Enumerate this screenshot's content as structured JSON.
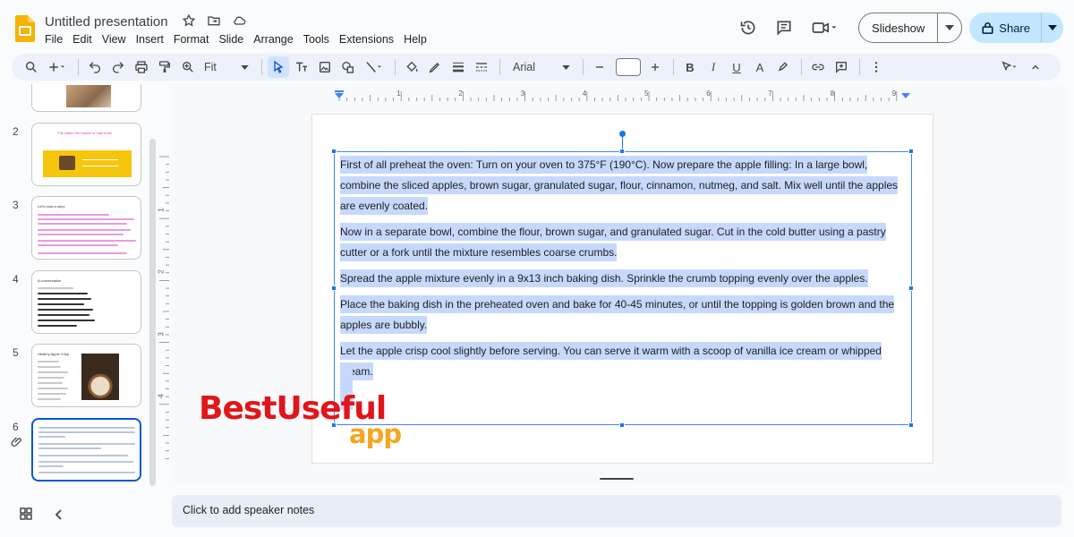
{
  "app": {
    "doc_title": "Untitled presentation",
    "menus": [
      "File",
      "Edit",
      "View",
      "Insert",
      "Format",
      "Slide",
      "Arrange",
      "Tools",
      "Extensions",
      "Help"
    ],
    "slideshow_label": "Slideshow",
    "share_label": "Share"
  },
  "toolbar": {
    "zoom": "Fit",
    "font": "Arial",
    "font_size": ""
  },
  "filmstrip": {
    "slides": [
      {
        "num": "2",
        "title": "The watch the makes of mail ends"
      },
      {
        "num": "3",
        "title": "Let's read a story"
      },
      {
        "num": "4",
        "title": "A conversation"
      },
      {
        "num": "5",
        "title": "Healthy Apple Crisp"
      },
      {
        "num": "6",
        "title": ""
      }
    ]
  },
  "slide": {
    "paragraphs": [
      "First of all preheat the oven: Turn on your oven to 375°F (190°C). Now prepare the apple filling: In a large bowl, combine the sliced apples, brown sugar, granulated sugar, flour, cinnamon, nutmeg, and salt. Mix well until the apples are evenly coated.",
      "Now in a separate bowl, combine the flour, brown sugar, and granulated sugar. Cut in the cold butter using a pastry cutter or a fork until the mixture resembles coarse crumbs.",
      "Spread the apple mixture evenly in a 9x13 inch baking dish. Sprinkle the crumb topping evenly over the apples.",
      "Place the baking dish in the preheated oven and bake for 40-45 minutes, or until the topping is golden brown and the apples are bubbly.",
      "Let the apple crisp cool slightly before serving. You can serve it warm with a scoop of vanilla ice cream or whipped cream."
    ]
  },
  "ruler": {
    "h_labels": [
      "1",
      "2",
      "3",
      "4",
      "5",
      "6",
      "7",
      "8",
      "9"
    ],
    "v_labels": [
      "1",
      "2",
      "3",
      "4"
    ]
  },
  "notes": {
    "placeholder": "Click to add speaker notes"
  },
  "watermark": {
    "line1": "BestUseful",
    "line2": "app"
  },
  "colors": {
    "accent": "#0b57d0",
    "selection": "#c6d9fc",
    "share_bg": "#c2e7ff",
    "watermark_red": "#e0161b",
    "watermark_orange": "#f5a623"
  }
}
